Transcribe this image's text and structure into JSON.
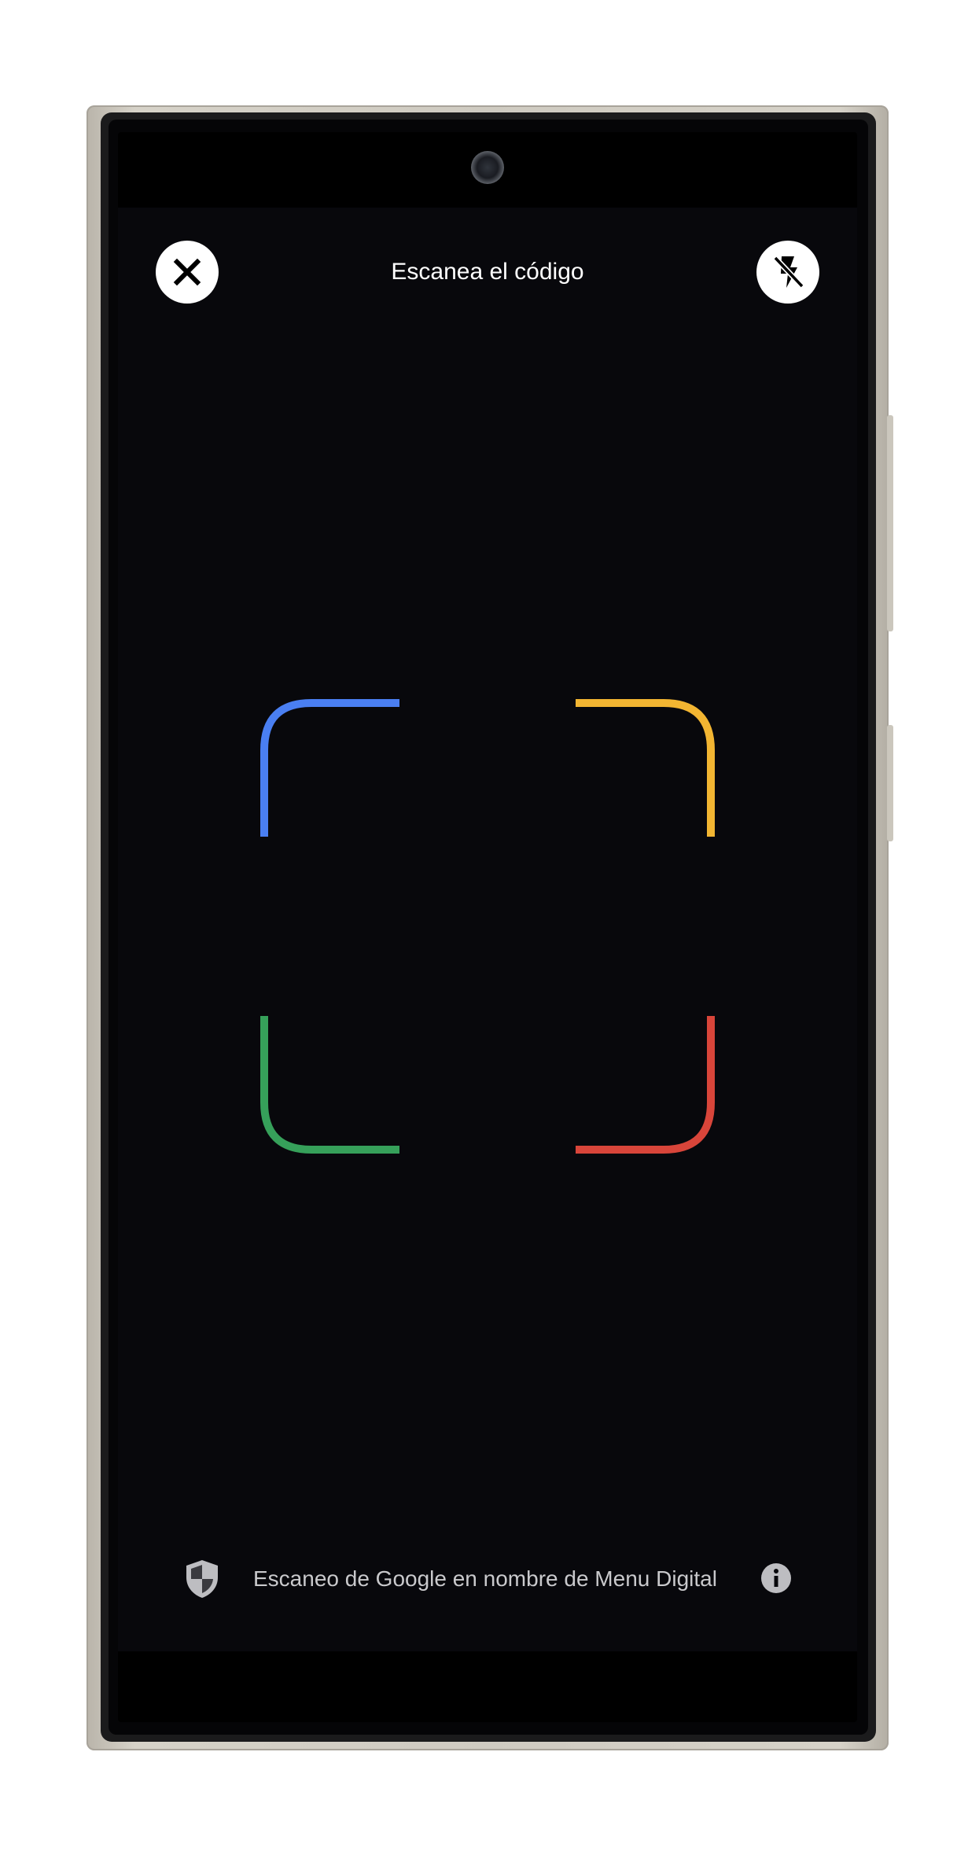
{
  "header": {
    "title": "Escanea el código",
    "close_icon": "close-icon",
    "flash_icon": "flash-off-icon"
  },
  "scanner": {
    "corner_colors": {
      "top_left": "#4a7ff2",
      "top_right": "#f2b532",
      "bottom_left": "#36a05a",
      "bottom_right": "#d8453a"
    }
  },
  "footer": {
    "text": "Escaneo de Google en nombre de Menu Digital",
    "shield_icon": "shield-icon",
    "info_icon": "info-icon"
  },
  "colors": {
    "screen_background": "#08080c",
    "button_background": "#ffffff",
    "title_text": "#ffffff",
    "footer_text": "#c9c9cc"
  }
}
